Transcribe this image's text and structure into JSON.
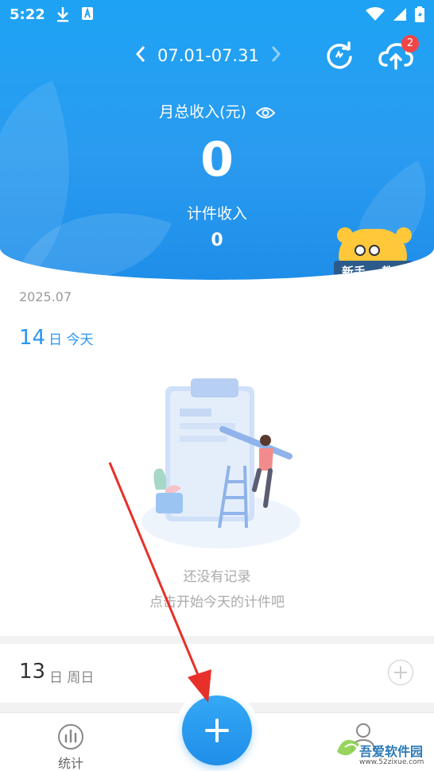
{
  "status_bar": {
    "time": "5:22"
  },
  "header": {
    "date_range": "07.01-07.31",
    "sync_badge": "2",
    "month_total_label": "月总收入(元)",
    "month_total_value": "0",
    "piece_income_label": "计件收入",
    "piece_income_value": "0",
    "tutorial": {
      "word1": "新手",
      "word2": "教程"
    }
  },
  "list": {
    "year_month": "2025.07",
    "today": {
      "day": "14",
      "suffix": "日 今天"
    },
    "empty_line1": "还没有记录",
    "empty_line2": "点击开始今天的计件吧",
    "previous_day": {
      "day": "13",
      "suffix": "日 周日"
    }
  },
  "bottom_nav": {
    "stats_label": "统计"
  },
  "watermark": {
    "text": "吾爱软件园",
    "url": "www.52zixue.com"
  },
  "colors": {
    "brand_blue": "#1e8ee9",
    "badge_red": "#f24545",
    "annotation_arrow": "#e8302a"
  },
  "icons": [
    "download-icon",
    "a-icon",
    "wifi-icon",
    "signal-icon",
    "battery-icon",
    "chevron-left-icon",
    "chevron-right-icon",
    "refresh-icon",
    "cloud-upload-icon",
    "eye-icon",
    "add-icon",
    "stats-icon",
    "profile-icon"
  ]
}
